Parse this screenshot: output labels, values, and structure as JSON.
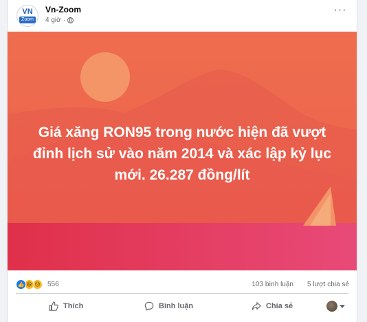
{
  "post": {
    "author": "Vn-Zoom",
    "avatar_text_top": "VN",
    "avatar_text_bottom": "Zoom",
    "time": "4 giờ",
    "privacy_icon": "globe-icon",
    "more_icon": "more-options-icon",
    "banner_text": "Giá xăng RON95 trong nước hiện đã vượt đỉnh lịch sử vào năm 2014 và xác lập kỷ lục mới. 26.287 đồng/lít",
    "banner_colors": {
      "sky": "#ee6a4e",
      "sun": "#f3936a",
      "mountain": "#e65d4b",
      "sea": "#e23e5e"
    }
  },
  "stats": {
    "reaction_icons": [
      "like-icon",
      "haha-icon",
      "sad-icon"
    ],
    "reaction_count": "556",
    "comments": "103 bình luận",
    "shares": "5 lượt chia sẻ"
  },
  "actions": {
    "like": "Thích",
    "comment": "Bình luận",
    "share": "Chia sẻ"
  }
}
